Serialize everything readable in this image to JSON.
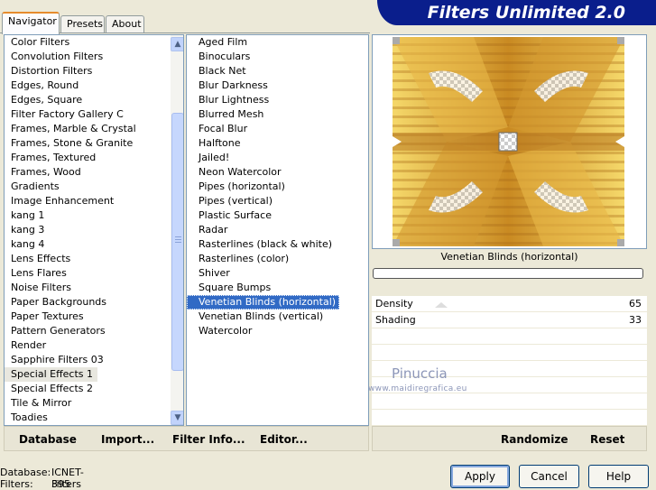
{
  "window": {
    "title": "Filters Unlimited 2.0"
  },
  "tabs": [
    {
      "label": "Navigator",
      "active": true
    },
    {
      "label": "Presets",
      "active": false
    },
    {
      "label": "About",
      "active": false
    }
  ],
  "categories": [
    "Color Filters",
    "Convolution Filters",
    "Distortion Filters",
    "Edges, Round",
    "Edges, Square",
    "Filter Factory Gallery C",
    "Frames, Marble & Crystal",
    "Frames, Stone & Granite",
    "Frames, Textured",
    "Frames, Wood",
    "Gradients",
    "Image Enhancement",
    "kang 1",
    "kang 3",
    "kang 4",
    "Lens Effects",
    "Lens Flares",
    "Noise Filters",
    "Paper Backgrounds",
    "Paper Textures",
    "Pattern Generators",
    "Render",
    "Sapphire Filters 03",
    "Special Effects 1",
    "Special Effects 2",
    "Tile & Mirror",
    "Toadies"
  ],
  "current_category": "Special Effects 1",
  "filters": [
    "Aged Film",
    "Binoculars",
    "Black Net",
    "Blur Darkness",
    "Blur Lightness",
    "Blurred Mesh",
    "Focal Blur",
    "Halftone",
    "Jailed!",
    "Neon Watercolor",
    "Pipes (horizontal)",
    "Pipes (vertical)",
    "Plastic Surface",
    "Radar",
    "Rasterlines (black & white)",
    "Rasterlines (color)",
    "Shiver",
    "Square Bumps",
    "Venetian Blinds (horizontal)",
    "Venetian Blinds (vertical)",
    "Watercolor"
  ],
  "selected_filter": "Venetian Blinds (horizontal)",
  "preview": {
    "filter_name": "Venetian Blinds (horizontal)"
  },
  "params": [
    {
      "label": "Density",
      "value": "65"
    },
    {
      "label": "Shading",
      "value": "33"
    }
  ],
  "watermark": {
    "name": "Pinuccia",
    "url": "www.maidiregrafica.eu"
  },
  "toolbar_left": {
    "database": "Database",
    "import": "Import...",
    "filter_info": "Filter Info...",
    "editor": "Editor..."
  },
  "toolbar_right": {
    "randomize": "Randomize",
    "reset": "Reset"
  },
  "status": {
    "database_label": "Database:",
    "database_value": "ICNET-Filters",
    "filters_label": "Filters:",
    "filters_value": "395"
  },
  "buttons": {
    "apply": "Apply",
    "cancel": "Cancel",
    "help": "Help"
  },
  "colors": {
    "banner": "#0a1e8c",
    "selection": "#316ac5",
    "tab_accent": "#e68b2c",
    "preview_gold": "#e8c040"
  },
  "icons": {
    "scroll_up": "chevron-up-icon",
    "scroll_down": "chevron-down-icon",
    "drag_grip": "grip-icon"
  }
}
